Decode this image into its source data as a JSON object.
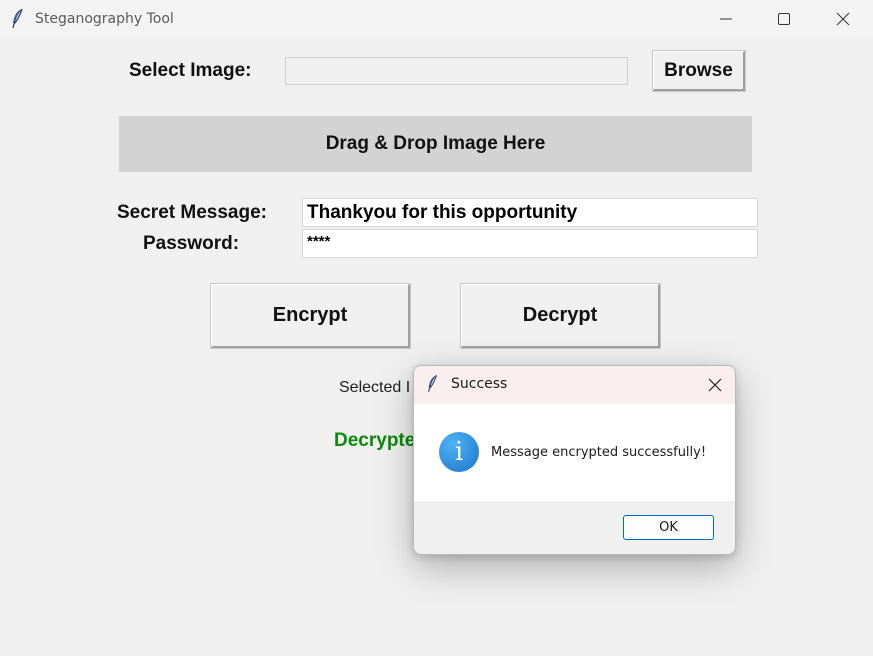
{
  "window": {
    "title": "Steganography Tool",
    "icon": "feather-icon",
    "controls": [
      "minimize-icon",
      "maximize-icon",
      "close-icon"
    ]
  },
  "form": {
    "select_image_label": "Select Image:",
    "image_path_value": "",
    "browse_label": "Browse",
    "dropzone_text": "Drag & Drop Image Here",
    "secret_message_label": "Secret Message:",
    "secret_message_value": "Thankyou for this opportunity",
    "password_label": "Password:",
    "password_value": "****",
    "encrypt_label": "Encrypt",
    "decrypt_label": "Decrypt",
    "selected_label": "Selected I",
    "decrypted_label": "Decrypte"
  },
  "dialog": {
    "title": "Success",
    "icon": "info-icon",
    "message": "Message encrypted successfully!",
    "ok_label": "OK"
  },
  "colors": {
    "dropzone_bg": "#d3d3d3",
    "decrypted_text": "#0b8a0b",
    "ok_border": "#0067c0",
    "dialog_title_bg": "#f9eeee"
  }
}
